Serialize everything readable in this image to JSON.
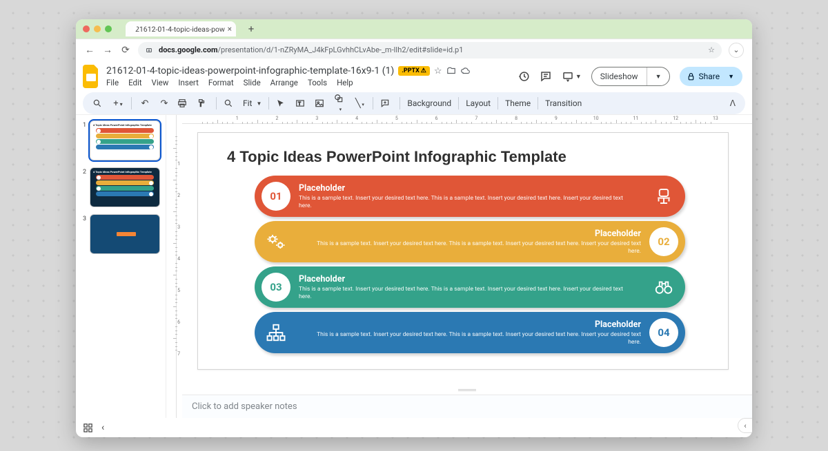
{
  "browser": {
    "tab_title": "21612-01-4-topic-ideas-pow",
    "url_prefix": "docs.google.com",
    "url_path": "/presentation/d/1-nZRyMA_J4kFpLGvhhCLvAbe-_m-lIh2/edit#slide=id.p1"
  },
  "doc": {
    "title": "21612-01-4-topic-ideas-powerpoint-infographic-template-16x9-1 (1)",
    "badge": ".PPTX",
    "menus": [
      "File",
      "Edit",
      "View",
      "Insert",
      "Format",
      "Slide",
      "Arrange",
      "Tools",
      "Help"
    ],
    "slideshow": "Slideshow",
    "share": "Share"
  },
  "toolbar": {
    "zoom": "Fit",
    "background": "Background",
    "layout": "Layout",
    "theme": "Theme",
    "transition": "Transition"
  },
  "rulerH": [
    1,
    2,
    3,
    4,
    5,
    6,
    7,
    8,
    9,
    10,
    11,
    12,
    13
  ],
  "rulerV": [
    1,
    2,
    3,
    4,
    5,
    6,
    7
  ],
  "thumbs": {
    "indices": [
      "1",
      "2",
      "3"
    ]
  },
  "slide": {
    "title": "4 Topic Ideas PowerPoint Infographic Template",
    "thumb_title": "4 Topic Ideas PowerPoint Infographic Template",
    "items": [
      {
        "num": "01",
        "title": "Placeholder",
        "sub": "This is a sample text. Insert your desired text here. This is a sample text. Insert your desired text here. Insert your desired text here.",
        "color": "#e05637"
      },
      {
        "num": "02",
        "title": "Placeholder",
        "sub": "This is a sample text. Insert your desired text here. This is a sample text. Insert your desired text here. Insert your desired text here.",
        "color": "#e9ae3b"
      },
      {
        "num": "03",
        "title": "Placeholder",
        "sub": "This is a sample text. Insert your desired text here. This is a sample text. Insert your desired text here. Insert your desired text here.",
        "color": "#34a28a"
      },
      {
        "num": "04",
        "title": "Placeholder",
        "sub": "This is a sample text. Insert your desired text here. This is a sample text. Insert your desired text here. Insert your desired text here.",
        "color": "#2b79b3"
      }
    ]
  },
  "notes": {
    "placeholder": "Click to add speaker notes"
  }
}
